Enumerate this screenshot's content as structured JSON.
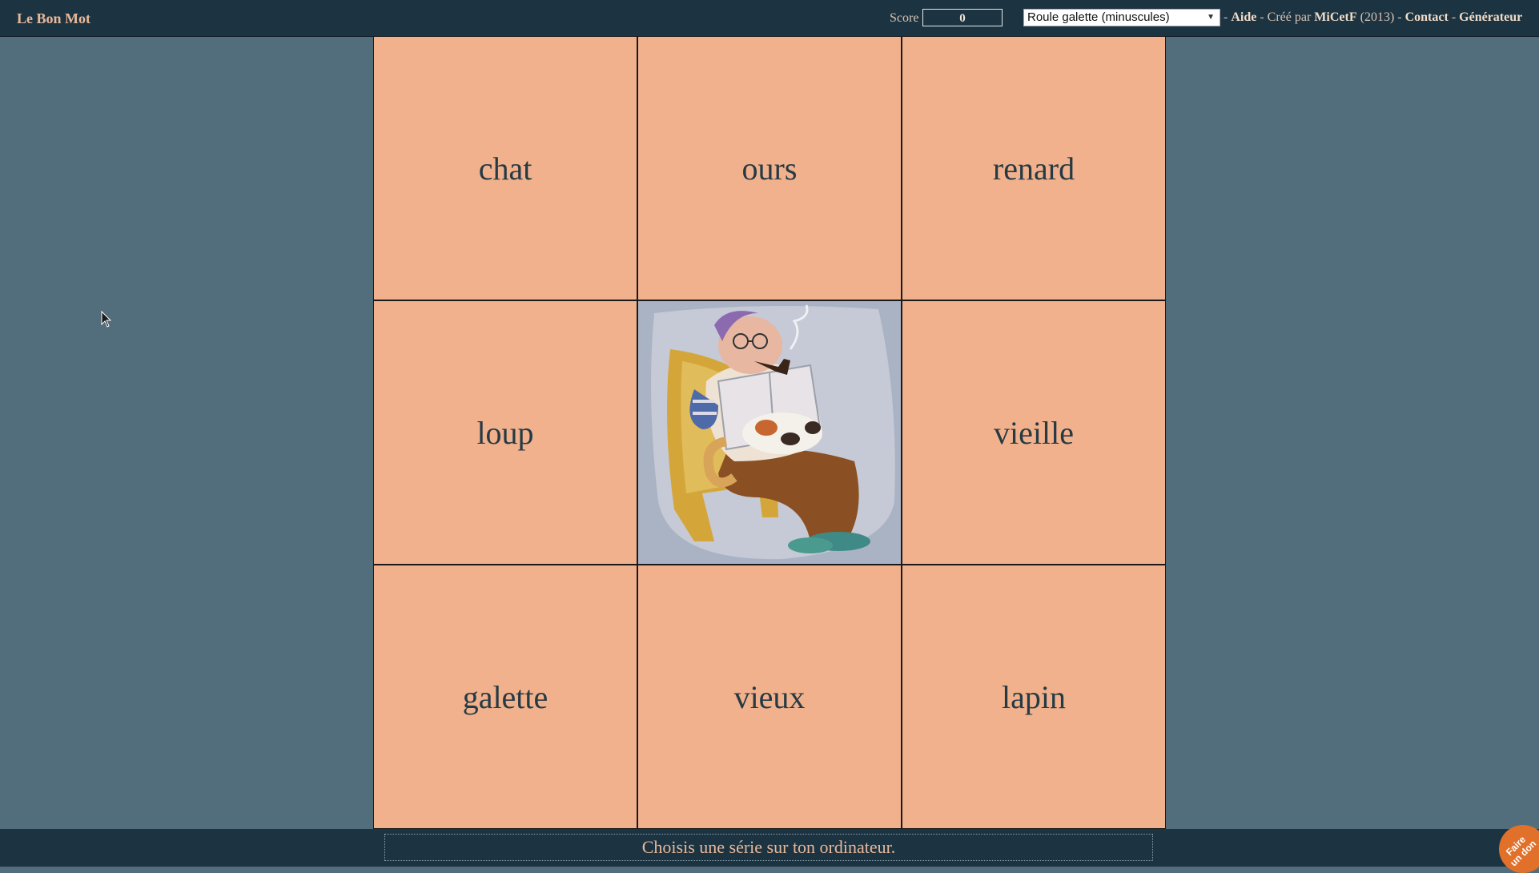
{
  "header": {
    "app_title": "Le Bon Mot",
    "score_label": "Score",
    "score_value": "0",
    "series_selected": "Roule galette (minuscules)",
    "sep1": " - ",
    "help_link": "Aide",
    "created_by_prefix": " - Créé par ",
    "author_link": "MiCetF",
    "year": " (2013)",
    "sep2": " - ",
    "contact_link": "Contact",
    "sep3": " - ",
    "generator_link": "Générateur"
  },
  "grid": {
    "cells": [
      "chat",
      "ours",
      "renard",
      "loup",
      "",
      "vieille",
      "galette",
      "vieux",
      "lapin"
    ],
    "center_image": "old-man-reading-with-cat"
  },
  "footer": {
    "message": "Choisis une série sur ton ordinateur.",
    "donate_badge": "Faire un don"
  },
  "colors": {
    "background": "#526d7b",
    "bar": "#1c3341",
    "cell": "#f1b18d",
    "accent": "#e8b89a"
  }
}
